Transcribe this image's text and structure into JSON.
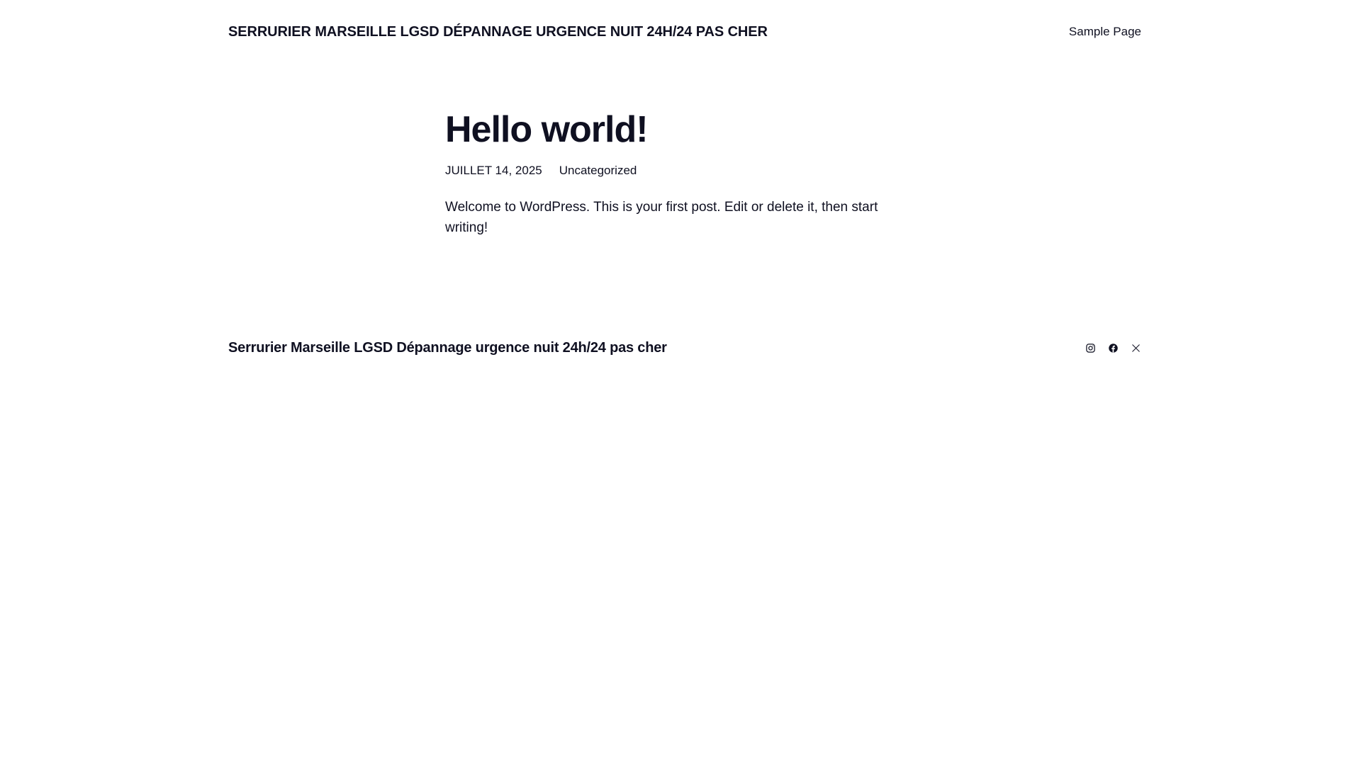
{
  "header": {
    "site_title": "SERRURIER MARSEILLE LGSD DÉPANNAGE URGENCE NUIT 24H/24 PAS CHER",
    "nav": [
      {
        "label": "Sample Page"
      }
    ]
  },
  "post": {
    "title": "Hello world!",
    "date": "JUILLET 14, 2025",
    "category": "Uncategorized",
    "body": "Welcome to WordPress. This is your first post. Edit or delete it, then start writing!"
  },
  "footer": {
    "site_title": "Serrurier Marseille LGSD Dépannage urgence nuit 24h/24 pas cher",
    "social": [
      {
        "icon": "instagram-icon"
      },
      {
        "icon": "facebook-icon"
      },
      {
        "icon": "x-icon"
      }
    ]
  },
  "colors": {
    "text": "#0f1021",
    "background": "#ffffff"
  }
}
